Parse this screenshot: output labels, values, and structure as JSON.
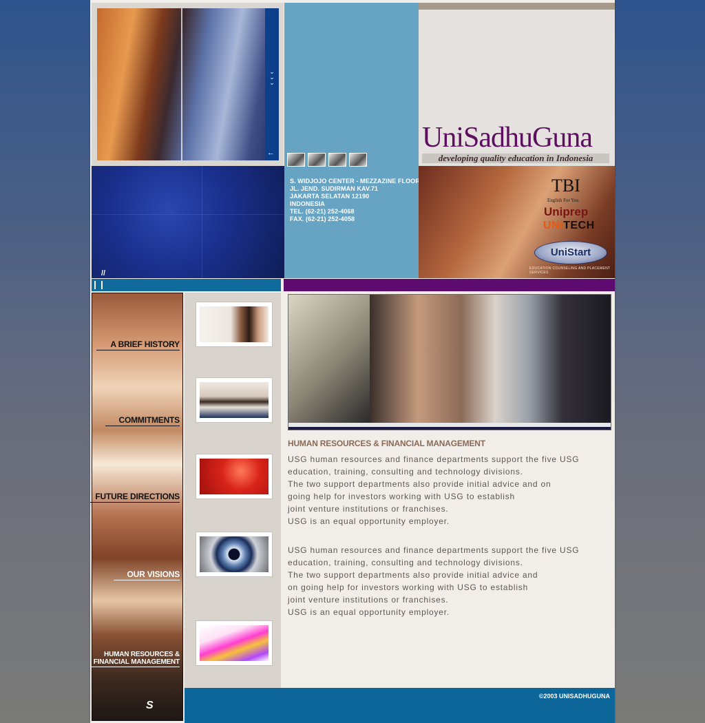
{
  "brand": {
    "name": "UniSadhuGuna",
    "tagline": "developing quality education in Indonesia",
    "primary_color": "#5d0f5f",
    "accent_color": "#106a9c"
  },
  "address": {
    "lines": [
      "S. WIDJOJO CENTER - MEZZAZINE FLOOR",
      "JL. JEND. SUDIRMAN KAV.71",
      "JAKARTA SELATAN 12190",
      "INDONESIA",
      "TEL. (62-21) 252-4068",
      "FAX. (62-21) 252-4058"
    ]
  },
  "partners": {
    "tbi": "TBI",
    "tbi_sub": "English For You",
    "uniprep": "Uniprep",
    "unitech_a": "UNI",
    "unitech_b": "TECH",
    "unistart": "UniStart",
    "unistart_sub": "EDUCATION COUNSELING AND PLACEMENT SERVICES"
  },
  "nav": {
    "items": [
      "A BRIEF HISTORY",
      "COMMITMENTS",
      "FUTURE DIRECTIONS",
      "OUR VISIONS",
      "HUMAN RESOURCES &",
      "FINANCIAL MANAGEMENT"
    ]
  },
  "content": {
    "section_title": "HUMAN RESOURCES & FINANCIAL MANAGEMENT",
    "para1": [
      "USG human resources and finance departments support the five USG",
      "education, training, consulting and technology divisions.",
      "The two support departments also provide initial advice and on",
      "going help for investors working with USG to establish",
      "joint venture institutions or franchises.",
      "USG is an equal opportunity employer."
    ],
    "para2": [
      "USG human resources and finance departments support the five USG",
      "education, training, consulting and technology divisions.",
      "The two support departments also provide initial advice and",
      "on going help for investors working with USG to establish",
      "joint venture institutions or franchises.",
      "USG is an equal opportunity employer."
    ]
  },
  "footer": {
    "copyright": "©2003 UNISADHUGUNA"
  }
}
